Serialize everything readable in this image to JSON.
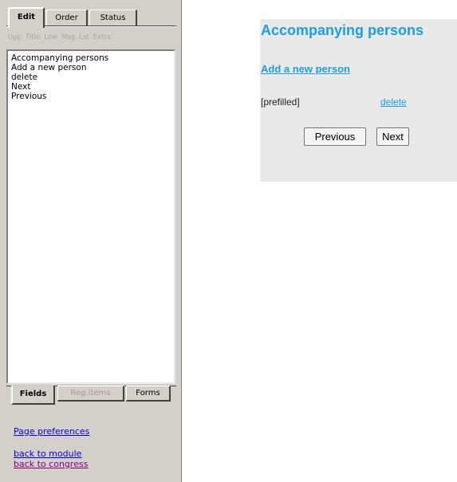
{
  "left_panel": {
    "top_tabs": [
      {
        "label": "Edit",
        "active": true
      },
      {
        "label": "Order",
        "active": false
      },
      {
        "label": "Status",
        "active": false
      }
    ],
    "toolbar": [
      "Upp",
      "Title",
      "Low",
      "Msg",
      "Lst",
      "Extra"
    ],
    "list_items": [
      "Accompanying persons",
      "Add a new person",
      "delete",
      "Next",
      "Previous"
    ],
    "bottom_tabs": [
      {
        "label": "Fields",
        "active": true,
        "enabled": true
      },
      {
        "label": "Reg.items",
        "active": false,
        "enabled": false
      },
      {
        "label": "Forms",
        "active": false,
        "enabled": true
      }
    ],
    "links": {
      "page_preferences": "Page preferences",
      "back_to_module": "back to module",
      "back_to_congress": "back to congress"
    }
  },
  "preview": {
    "title": "Accompanying persons",
    "add_link": "Add a new person",
    "prefilled": "[prefilled]",
    "delete_link": "delete",
    "prev_button": "Previous",
    "next_button": "Next",
    "colors": {
      "accent": "#1a9fe0",
      "background": "#e9e9e9"
    }
  }
}
